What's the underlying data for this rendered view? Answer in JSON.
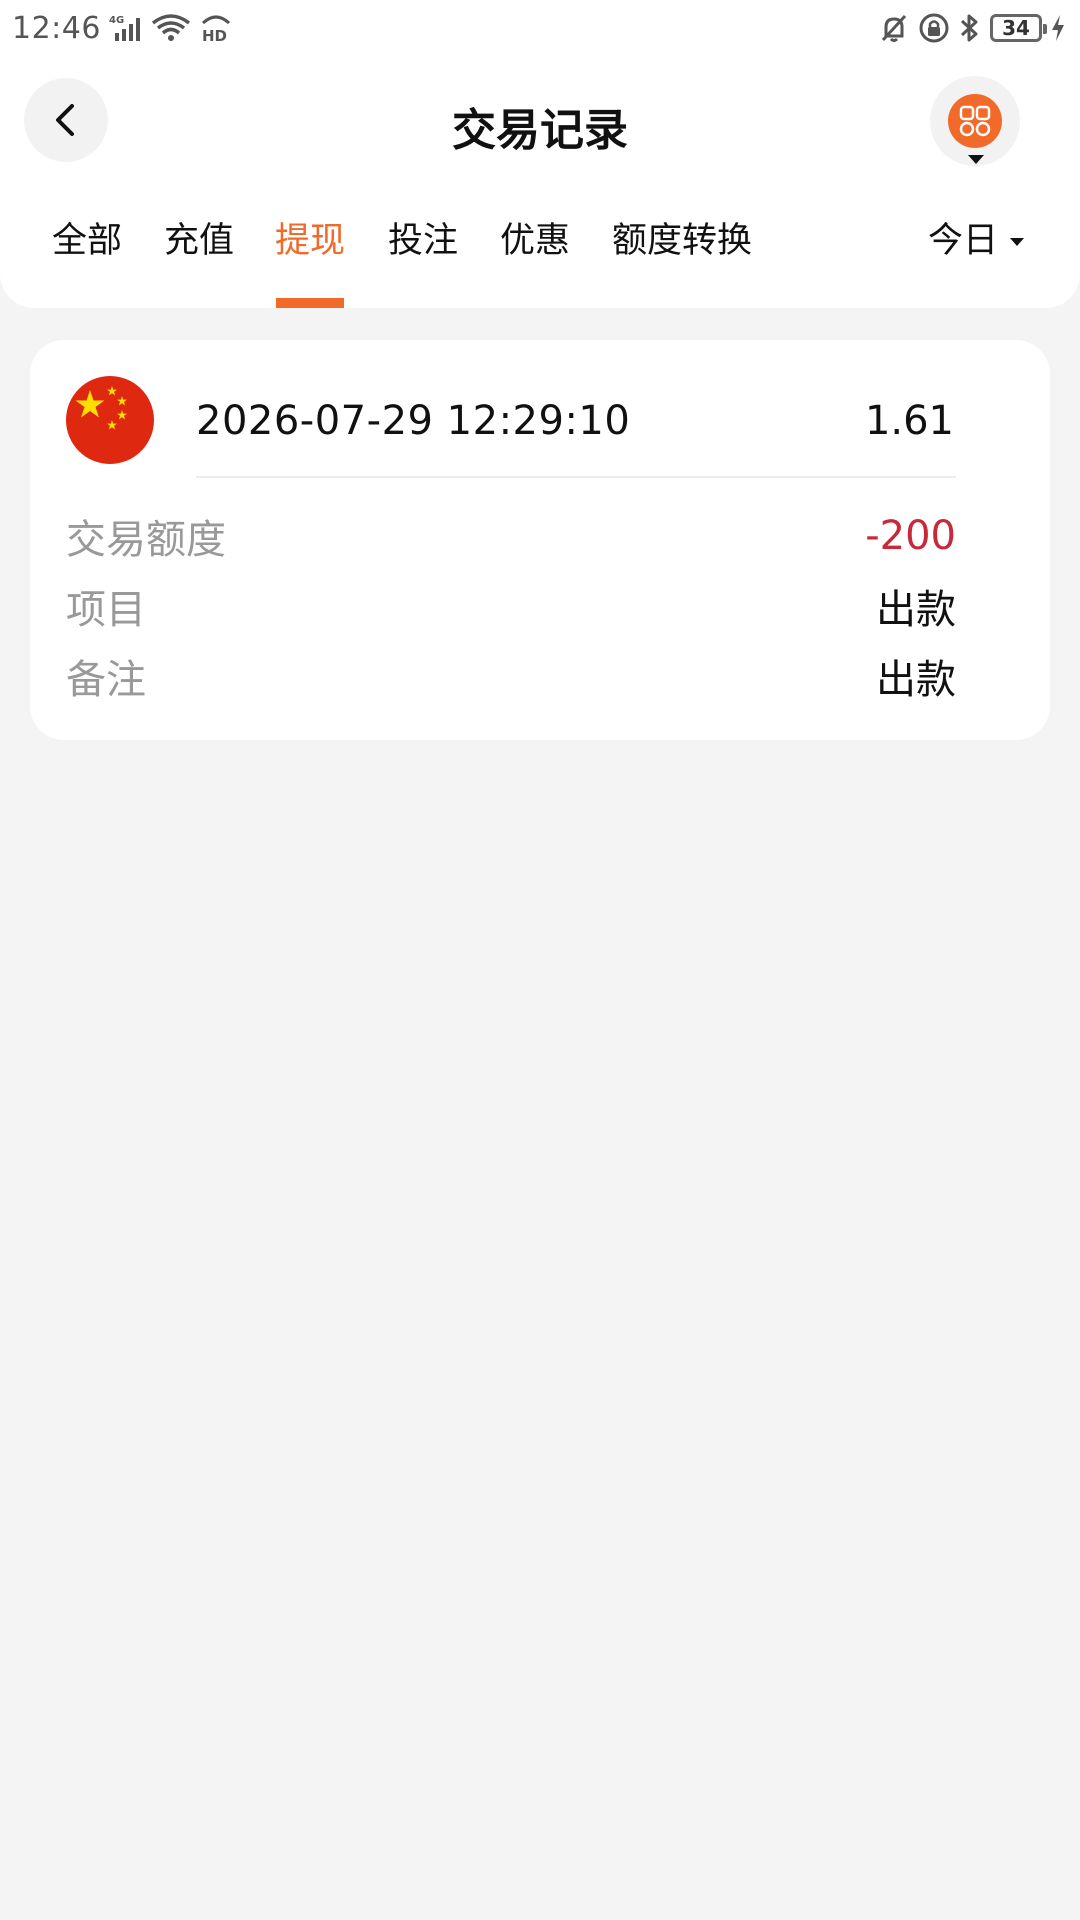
{
  "status_bar": {
    "time": "12:46",
    "network": "4G",
    "hd": "HD",
    "battery": "34"
  },
  "header": {
    "title": "交易记录"
  },
  "tabs": [
    {
      "label": "全部",
      "active": false
    },
    {
      "label": "充值",
      "active": false
    },
    {
      "label": "提现",
      "active": true
    },
    {
      "label": "投注",
      "active": false
    },
    {
      "label": "优惠",
      "active": false
    },
    {
      "label": "额度转换",
      "active": false
    }
  ],
  "filter": {
    "label": "今日"
  },
  "record": {
    "time": "2026-07-29 12:29:10",
    "amount": "1.61",
    "rows": [
      {
        "label": "交易额度",
        "value": "-200"
      },
      {
        "label": "项目",
        "value": "出款"
      },
      {
        "label": "备注",
        "value": "出款"
      }
    ]
  },
  "colors": {
    "accent": "#f26a2a",
    "negative": "#c62a3a",
    "background": "#f4f4f4"
  }
}
